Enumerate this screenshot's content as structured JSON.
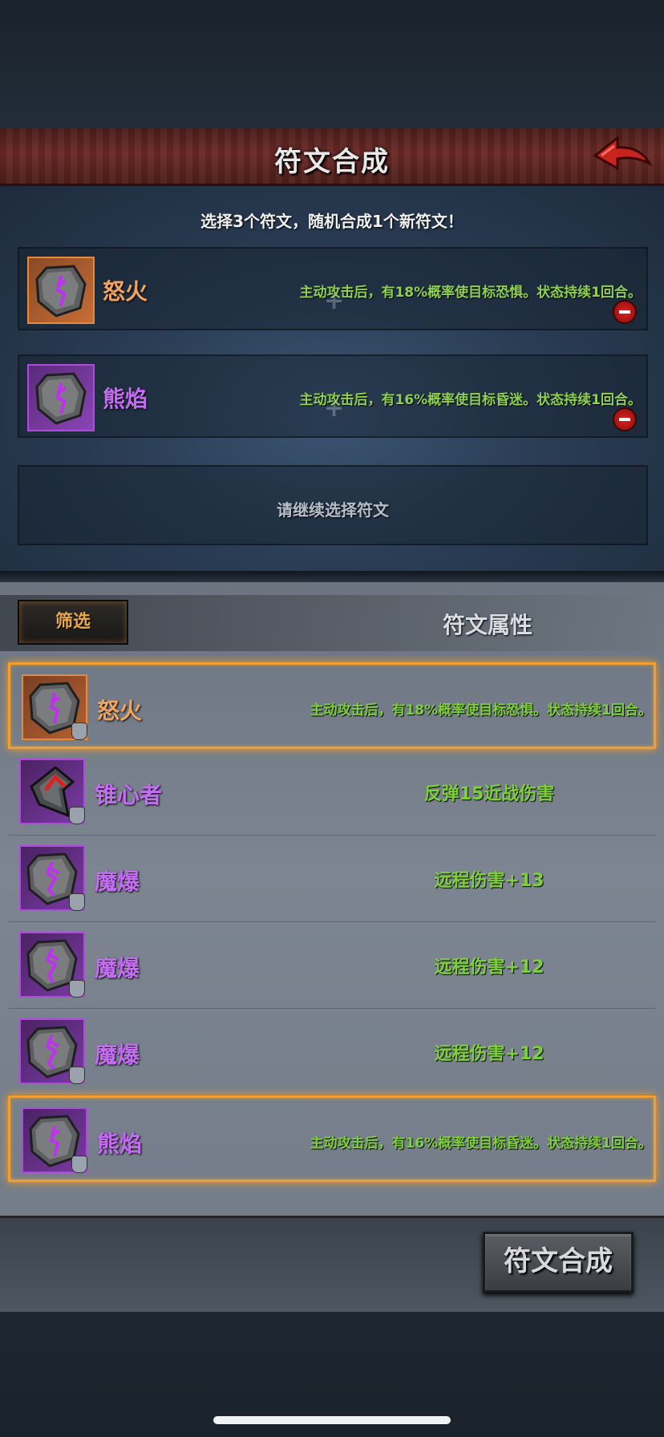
{
  "title": "符文合成",
  "instruction": "选择3个符文，随机合成1个新符文！",
  "selected_slots": [
    {
      "name": "怒火",
      "color": "orange",
      "desc": "主动攻击后，有18%概率使目标恐惧。状态持续1回合。"
    },
    {
      "name": "熊焰",
      "color": "purple",
      "desc": "主动攻击后，有16%概率使目标昏迷。状态持续1回合。"
    }
  ],
  "plus_symbol": "+",
  "empty_slot_hint": "请继续选择符文",
  "filter_label": "筛选",
  "attr_header": "符文属性",
  "runes": [
    {
      "name": "怒火",
      "color": "orange",
      "desc": "主动攻击后，有18%概率使目标恐惧。状态持续1回合。",
      "selected": true
    },
    {
      "name": "锥心者",
      "color": "purple",
      "desc": "反弹15近战伤害",
      "selected": false
    },
    {
      "name": "魔爆",
      "color": "purple",
      "desc": "远程伤害+13",
      "selected": false
    },
    {
      "name": "魔爆",
      "color": "purple",
      "desc": "远程伤害+12",
      "selected": false
    },
    {
      "name": "魔爆",
      "color": "purple",
      "desc": "远程伤害+12",
      "selected": false
    },
    {
      "name": "熊焰",
      "color": "purple",
      "desc": "主动攻击后，有16%概率使目标昏迷。状态持续1回合。",
      "selected": true
    }
  ],
  "merge_button": "符文合成",
  "colors": {
    "orange": "#f0a460",
    "purple": "#c46cf2",
    "green_desc": "#7ed03a",
    "highlight": "#f0a030"
  },
  "icons": {
    "back": "back-arrow-icon",
    "remove": "minus-icon",
    "rune": "rune-stone-icon",
    "lock": "lock-icon"
  }
}
